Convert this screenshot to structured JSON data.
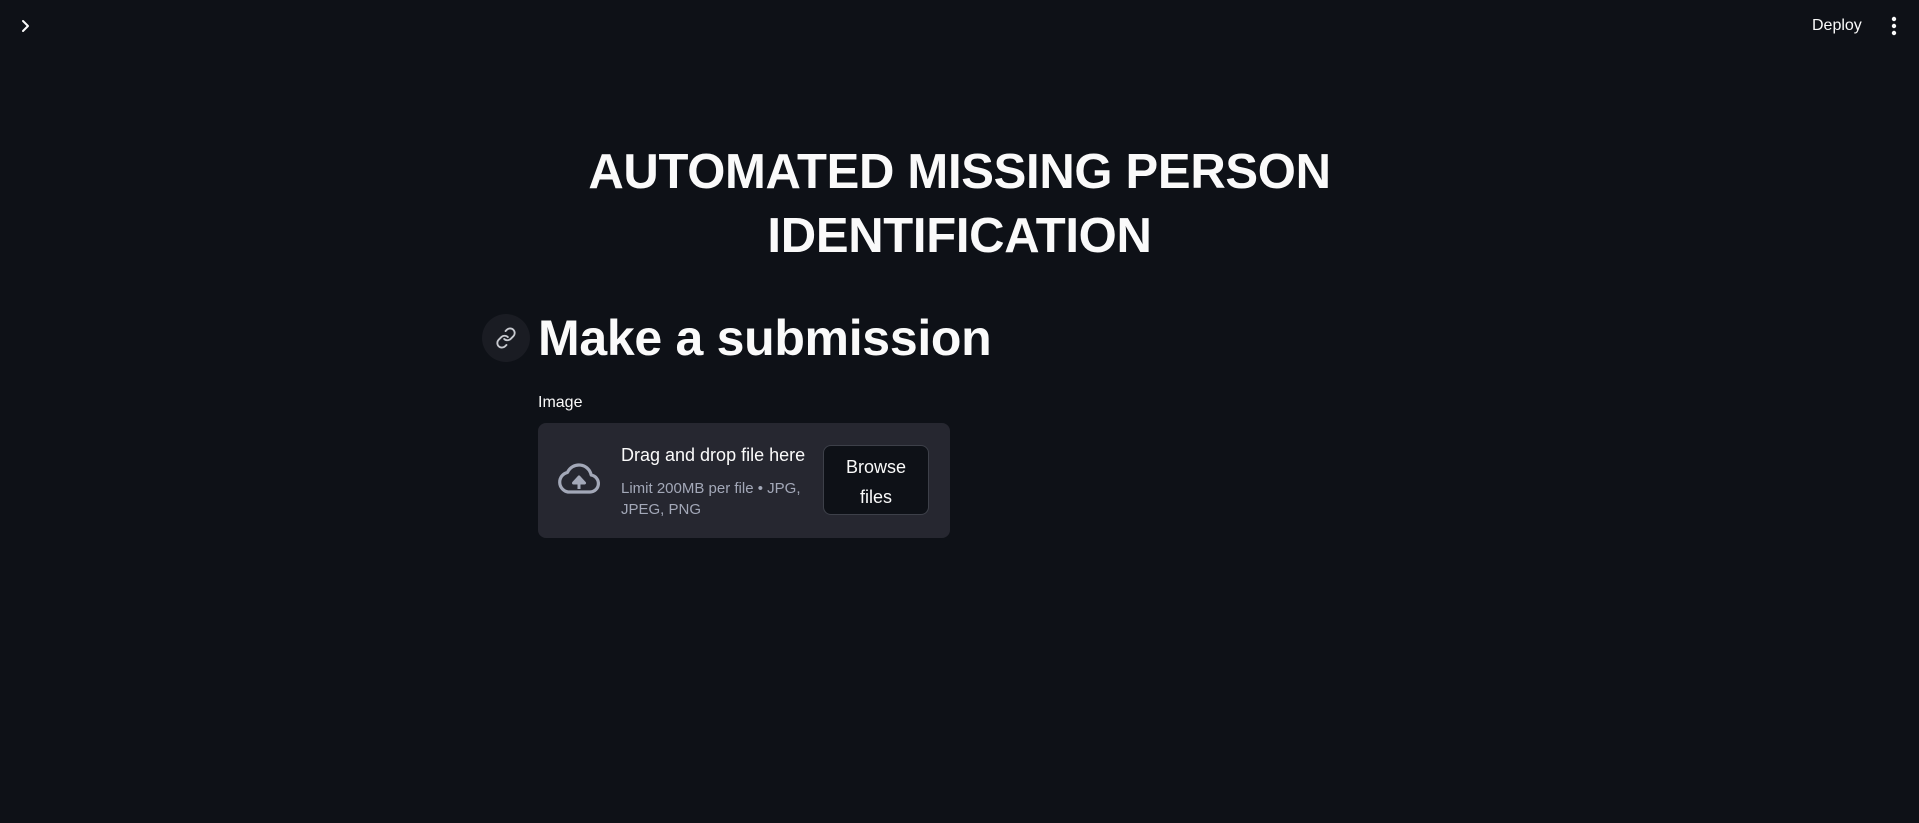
{
  "header": {
    "sidebar_toggle_icon": "chevron-right-icon",
    "deploy_label": "Deploy",
    "menu_icon": "kebab-menu-icon"
  },
  "main": {
    "title_line1": "AUTOMATED MISSING PERSON",
    "title_line2": "IDENTIFICATION",
    "section_heading": "Make a submission",
    "anchor_icon": "link-icon",
    "uploader": {
      "label": "Image",
      "icon": "cloud-upload-icon",
      "instruction": "Drag and drop file here",
      "limit_line1": "Limit 200MB per file • JPG,",
      "limit_line2": "JPEG, PNG",
      "browse_line1": "Browse",
      "browse_line2": "files"
    }
  },
  "colors": {
    "background": "#0e1117",
    "dropzone": "#262730",
    "text": "#fafafa",
    "muted_text": "#a3a8b8"
  }
}
